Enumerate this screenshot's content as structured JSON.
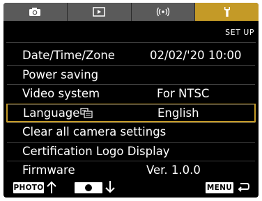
{
  "tabs": [
    {
      "icon": "camera-icon",
      "active": false
    },
    {
      "icon": "playback-icon",
      "active": false
    },
    {
      "icon": "wireless-icon",
      "active": false
    },
    {
      "icon": "wrench-icon",
      "active": true
    }
  ],
  "tab_label": "SET UP",
  "menu": [
    {
      "label": "Date/Time/Zone",
      "value": "02/02/'20 10:00"
    },
    {
      "label": "Power saving",
      "value": ""
    },
    {
      "label": "Video system",
      "value": "For NTSC"
    },
    {
      "label": "Language",
      "value": "English",
      "icon": "language-icon",
      "selected": true
    },
    {
      "label": "Clear all camera settings",
      "value": ""
    },
    {
      "label": "Certification Logo Display",
      "value": ""
    },
    {
      "label": "Firmware",
      "value": "Ver. 1.0.0"
    }
  ],
  "bottom": {
    "photo_label": "PHOTO",
    "photo_arrow": "up-arrow-icon",
    "rec_icon": "record-button-icon",
    "rec_arrow": "down-arrow-icon",
    "menu_label": "MENU",
    "menu_arrow": "back-arrow-icon"
  },
  "colors": {
    "accent": "#c49a27",
    "tab_inactive": "#5a5a5a",
    "background": "#000000"
  }
}
